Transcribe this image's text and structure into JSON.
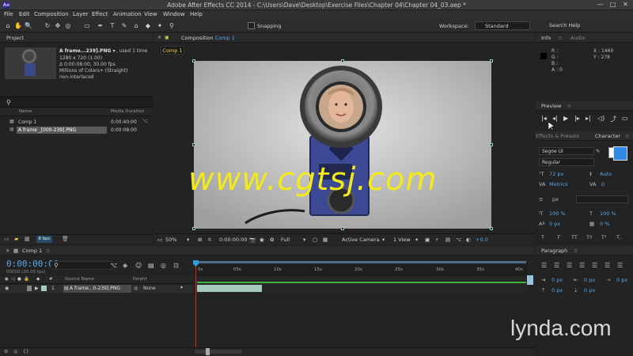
{
  "window": {
    "app_icon": "Ae",
    "title": "Adobe After Effects CC 2014 - C:\\Users\\Dave\\Desktop\\Exercise Files\\Chapter 04\\Chapter 04_03.aep *",
    "minimize": "—",
    "maximize": "□",
    "close": "✕"
  },
  "menu": [
    "File",
    "Edit",
    "Composition",
    "Layer",
    "Effect",
    "Animation",
    "View",
    "Window",
    "Help"
  ],
  "toolbar": {
    "tools": [
      "⌂",
      "✋",
      "🔍",
      "↻",
      "✥",
      "◎",
      "▭",
      "✒",
      "T",
      "✎",
      "⌂",
      "◆",
      "✦",
      "⚲"
    ],
    "snapping_label": "Snapping",
    "workspace_label": "Workspace:",
    "workspace_value": "Standard",
    "search_help": "Search Help"
  },
  "project": {
    "tab": "Project",
    "selected_item": "A frame...239].PNG ▾",
    "used": ", used 1 time",
    "info_lines": [
      "1280 x 720 (1.00)",
      "Δ 0:00:08:00, 30.00 fps",
      "Millions of Colors+ (Straight)",
      "non-interlaced"
    ],
    "columns": [
      "Name",
      "Media Duration"
    ],
    "items": [
      {
        "name": "Comp 1",
        "duration": "0:00:40:00"
      },
      {
        "name": "A frame _[000-239].PNG",
        "duration": "0:00:08:00"
      }
    ],
    "bpc": "8 bpc"
  },
  "composition": {
    "tab_prefix": "Composition",
    "tab_name": "Comp 1",
    "subtab": "Comp 1",
    "zoom": "50%",
    "timecode": "0:00:00:00",
    "resolution": "Full",
    "camera": "Active Camera",
    "views": "1 View",
    "exposure": "+0.0"
  },
  "watermark": "www.cgtsj.com",
  "info": {
    "tab1": "Info",
    "tab2": "Audio",
    "r": "R :",
    "g": "G :",
    "b": "B :",
    "a": "A : 0",
    "x": "X : 1460",
    "y": "Y : 278"
  },
  "preview": {
    "tab": "Preview",
    "buttons": [
      "|◂",
      "◂|",
      "▶",
      "|▸",
      "▸|",
      "◁)",
      "⤴",
      "▭"
    ]
  },
  "effects_tab": "Effects & Presets",
  "character": {
    "tab": "Character",
    "font": "Segoe UI",
    "style": "Regular",
    "size": "72 px",
    "leading": "Auto",
    "kerning": "Metrics",
    "tracking": "0",
    "stroke": "px",
    "vscale": "100 %",
    "hscale": "100 %",
    "baseline": "0 px",
    "tsume": "0 %",
    "styles": [
      "T",
      "T",
      "TT",
      "Tт",
      "T¹",
      "T,"
    ]
  },
  "paragraph": {
    "tab": "Paragraph",
    "indent_values": [
      "0 px",
      "0 px",
      "0 px",
      "0 px",
      "0 px"
    ]
  },
  "timeline": {
    "tab": "Comp 1",
    "timecode": "0:00:00:00",
    "fps": "00000 (30.00 fps)",
    "columns": [
      "Source Name",
      "Parent"
    ],
    "ticks": [
      "0s",
      "05s",
      "10s",
      "15s",
      "20s",
      "25s",
      "30s",
      "35s",
      "40s"
    ],
    "layer": {
      "index": "1",
      "name": "A frame...0-239].PNG",
      "parent": "None"
    }
  },
  "branding": "lynda.com",
  "colors": {
    "accent": "#5aa8e8",
    "watermark": "#f2ea1b",
    "layer_bar": "#a5c8bf",
    "playhead": "#dd2222",
    "fill_swatch": "#2f8be5"
  }
}
